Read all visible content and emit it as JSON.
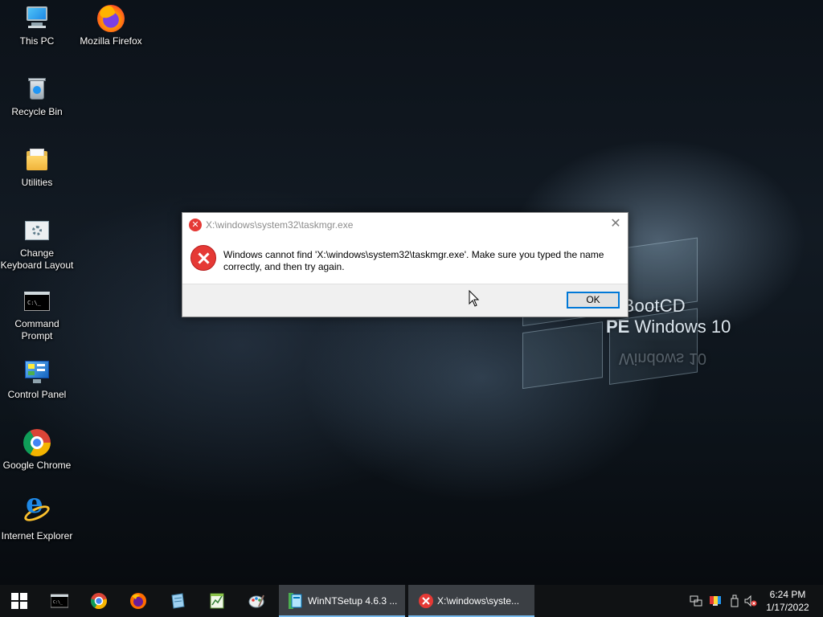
{
  "desktop": {
    "icons": [
      {
        "label": "This PC",
        "icon": "this-pc-icon"
      },
      {
        "label": "Mozilla Firefox",
        "icon": "firefox-icon"
      },
      {
        "label": "Recycle Bin",
        "icon": "recycle-bin-icon"
      },
      {
        "label": "Utilities",
        "icon": "folder-icon"
      },
      {
        "label": "Change Keyboard Layout",
        "icon": "keyboard-settings-icon"
      },
      {
        "label": "Command Prompt",
        "icon": "command-prompt-icon"
      },
      {
        "label": "Control Panel",
        "icon": "control-panel-icon"
      },
      {
        "label": "Google Chrome",
        "icon": "chrome-icon"
      },
      {
        "label": "Internet Explorer",
        "icon": "internet-explorer-icon"
      }
    ],
    "wallpaper_text": {
      "line1": "n’s BootCD",
      "line2_bold": "PE",
      "line2_rest": " Windows 10",
      "reflection": "Windows 10"
    }
  },
  "dialog": {
    "title": "X:\\windows\\system32\\taskmgr.exe",
    "message": "Windows cannot find 'X:\\windows\\system32\\taskmgr.exe'. Make sure you typed the name correctly, and then try again.",
    "ok_label": "OK",
    "close_glyph": "✕",
    "icon": "error-icon",
    "accent_color": "#0078d7",
    "error_color": "#e53935"
  },
  "taskbar": {
    "start_icon": "windows-start-icon",
    "pinned": [
      "command-prompt-icon",
      "chrome-icon",
      "firefox-icon",
      "notepad-icon",
      "spreadsheet-icon",
      "paint-icon"
    ],
    "tasks": [
      {
        "label": "WinNTSetup 4.6.3 ...",
        "icon": "winntsetup-icon"
      },
      {
        "label": "X:\\windows\\syste...",
        "icon": "error-icon"
      }
    ],
    "tray_icons": [
      "network-icon",
      "display-color-icon",
      "usb-drive-icon",
      "volume-muted-icon"
    ],
    "clock": {
      "time": "6:24 PM",
      "date": "1/17/2022"
    },
    "highlight_color": "#76b9ed"
  }
}
